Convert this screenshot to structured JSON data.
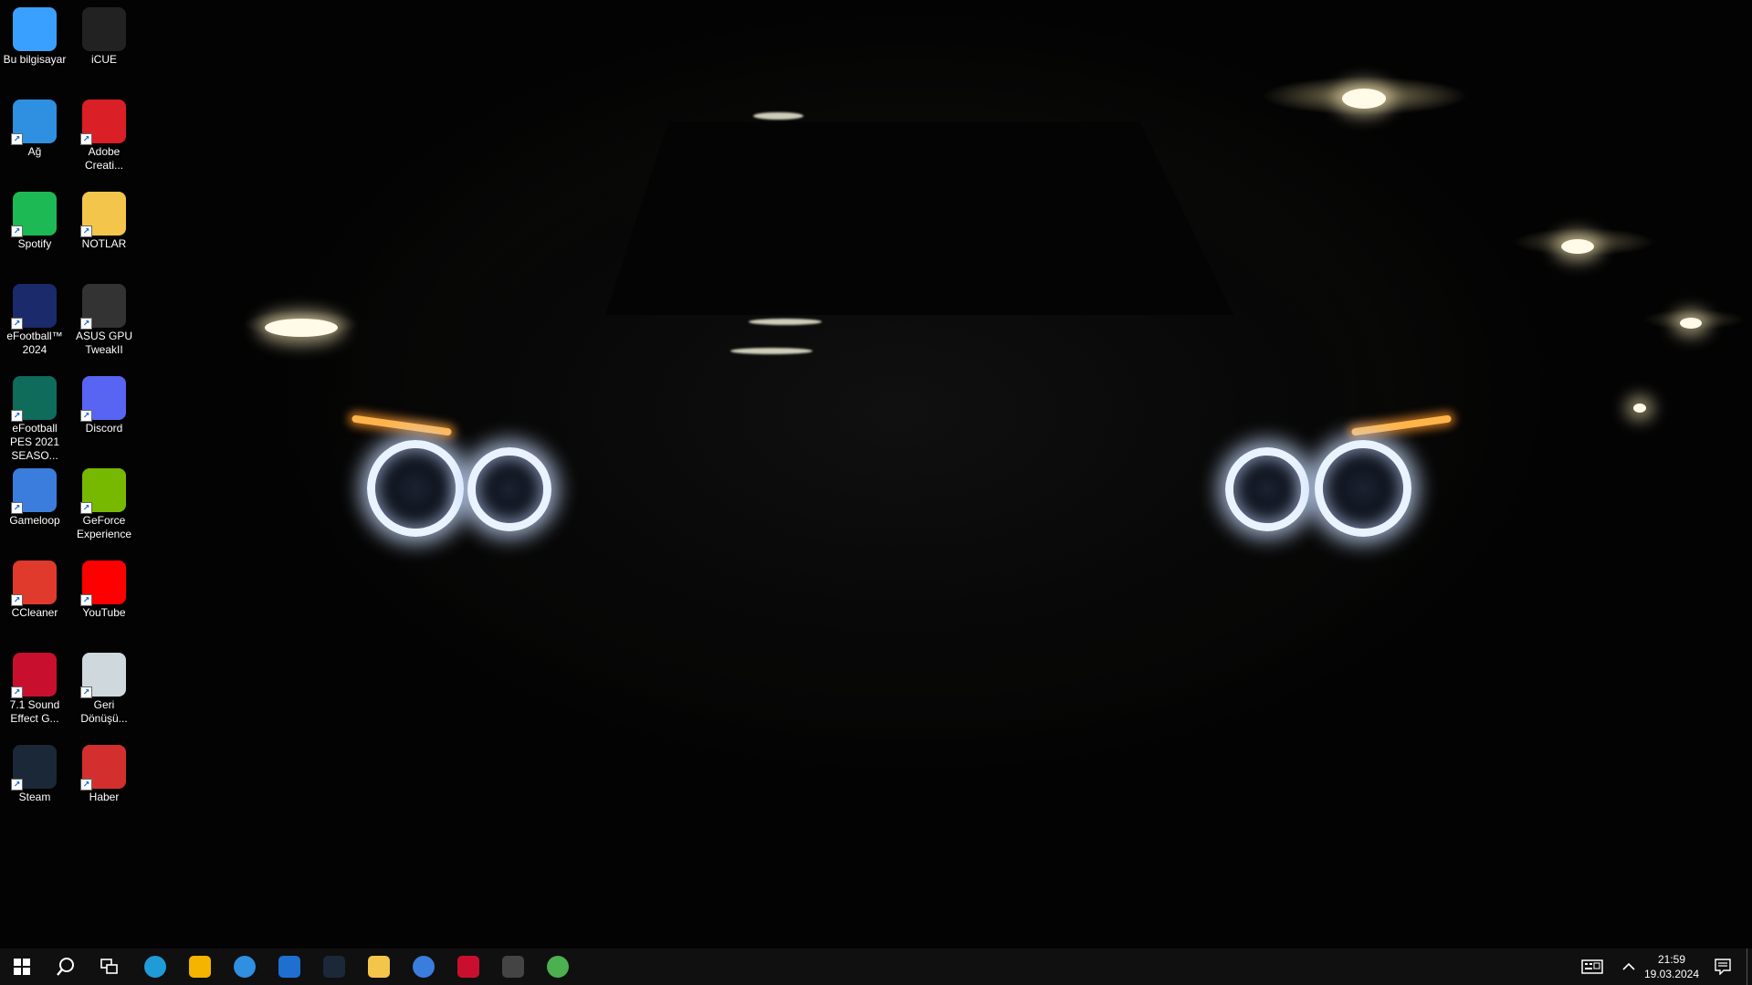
{
  "desktop": {
    "icons": [
      {
        "label": "Bu bilgisayar",
        "icon": "computer-icon",
        "color": "#3aa0ff"
      },
      {
        "label": "iCUE",
        "icon": "icue-icon",
        "color": "#222222"
      },
      {
        "label": "Ağ",
        "icon": "network-icon",
        "color": "#2f8fe0"
      },
      {
        "label": "Adobe Creati...",
        "icon": "adobe-creative-cloud-icon",
        "color": "#da1f26"
      },
      {
        "label": "Spotify",
        "icon": "spotify-icon",
        "color": "#1db954"
      },
      {
        "label": "NOTLAR",
        "icon": "folder-icon",
        "color": "#f3c54a"
      },
      {
        "label": "eFootball™ 2024",
        "icon": "efootball-icon",
        "color": "#1b2a6b"
      },
      {
        "label": "ASUS GPU TweakII",
        "icon": "asus-gpu-tweak-icon",
        "color": "#333333"
      },
      {
        "label": "eFootball PES 2021 SEASO...",
        "icon": "pes-2021-icon",
        "color": "#0f6b5a"
      },
      {
        "label": "Discord",
        "icon": "discord-icon",
        "color": "#5865f2"
      },
      {
        "label": "Gameloop",
        "icon": "gameloop-icon",
        "color": "#3b7ddd"
      },
      {
        "label": "GeForce Experience",
        "icon": "nvidia-icon",
        "color": "#76b900"
      },
      {
        "label": "CCleaner",
        "icon": "ccleaner-icon",
        "color": "#e03a2d"
      },
      {
        "label": "YouTube",
        "icon": "youtube-icon",
        "color": "#ff0000"
      },
      {
        "label": "7.1 Sound Effect G...",
        "icon": "sound-effect-icon",
        "color": "#c8102e"
      },
      {
        "label": "Geri Dönüşü...",
        "icon": "recycle-bin-icon",
        "color": "#cfd8dc"
      },
      {
        "label": "Steam",
        "icon": "steam-icon",
        "color": "#1b2838"
      },
      {
        "label": "Haber",
        "icon": "news-icon",
        "color": "#d32f2f"
      }
    ]
  },
  "taskbar": {
    "start_icon": "windows-icon",
    "search_icon": "search-icon",
    "taskview_icon": "task-view-icon",
    "apps": [
      {
        "name": "edge",
        "icon": "edge-icon",
        "color": "#1f9bd8"
      },
      {
        "name": "store",
        "icon": "store-icon",
        "color": "#f4b400"
      },
      {
        "name": "internet-explorer",
        "icon": "internet-explorer-icon",
        "color": "#2f8fe0"
      },
      {
        "name": "media-player",
        "icon": "media-player-icon",
        "color": "#1e6fd0"
      },
      {
        "name": "steam",
        "icon": "steam-icon",
        "color": "#1b2838"
      },
      {
        "name": "file-explorer",
        "icon": "folder-icon",
        "color": "#f3c54a"
      },
      {
        "name": "gameloop",
        "icon": "gameloop-icon",
        "color": "#3b7ddd"
      },
      {
        "name": "sound-effect",
        "icon": "sound-effect-icon",
        "color": "#c8102e"
      },
      {
        "name": "asus-gpu-tweak",
        "icon": "asus-gpu-tweak-icon",
        "color": "#444444"
      },
      {
        "name": "chrome",
        "icon": "chrome-icon",
        "color": "#4caf50"
      }
    ],
    "tray": {
      "keyboard_icon": "keyboard-icon",
      "chevron_icon": "chevron-up-icon",
      "time": "21:59",
      "date": "19.03.2024",
      "notification_icon": "notification-icon"
    }
  }
}
